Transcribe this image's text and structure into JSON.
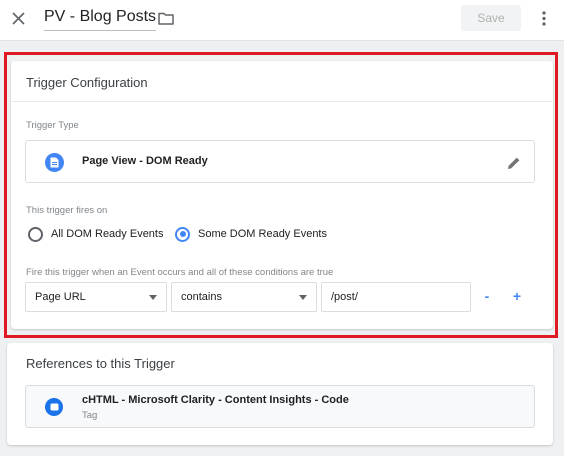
{
  "header": {
    "title": "PV - Blog Posts",
    "save_label": "Save",
    "close_icon": "close-icon",
    "folder_icon": "folder-icon",
    "more_icon": "more-vert-icon"
  },
  "trigger_config": {
    "title": "Trigger Configuration",
    "type_label": "Trigger Type",
    "type_value": "Page View - DOM Ready",
    "type_icon": "document-icon",
    "edit_icon": "pencil-icon",
    "fires_on_label": "This trigger fires on",
    "options": [
      {
        "label": "All DOM Ready Events",
        "checked": false
      },
      {
        "label": "Some DOM Ready Events",
        "checked": true
      }
    ],
    "conditions_label": "Fire this trigger when an Event occurs and all of these conditions are true",
    "condition": {
      "variable": "Page URL",
      "operator": "contains",
      "value": "/post/"
    },
    "remove_label": "-",
    "add_label": "+"
  },
  "references": {
    "title": "References to this Trigger",
    "items": [
      {
        "name": "cHTML - Microsoft Clarity - Content Insights - Code",
        "type": "Tag",
        "icon": "tag-icon"
      }
    ]
  },
  "colors": {
    "accent": "#4285f4",
    "highlight_border": "#e01a22"
  }
}
